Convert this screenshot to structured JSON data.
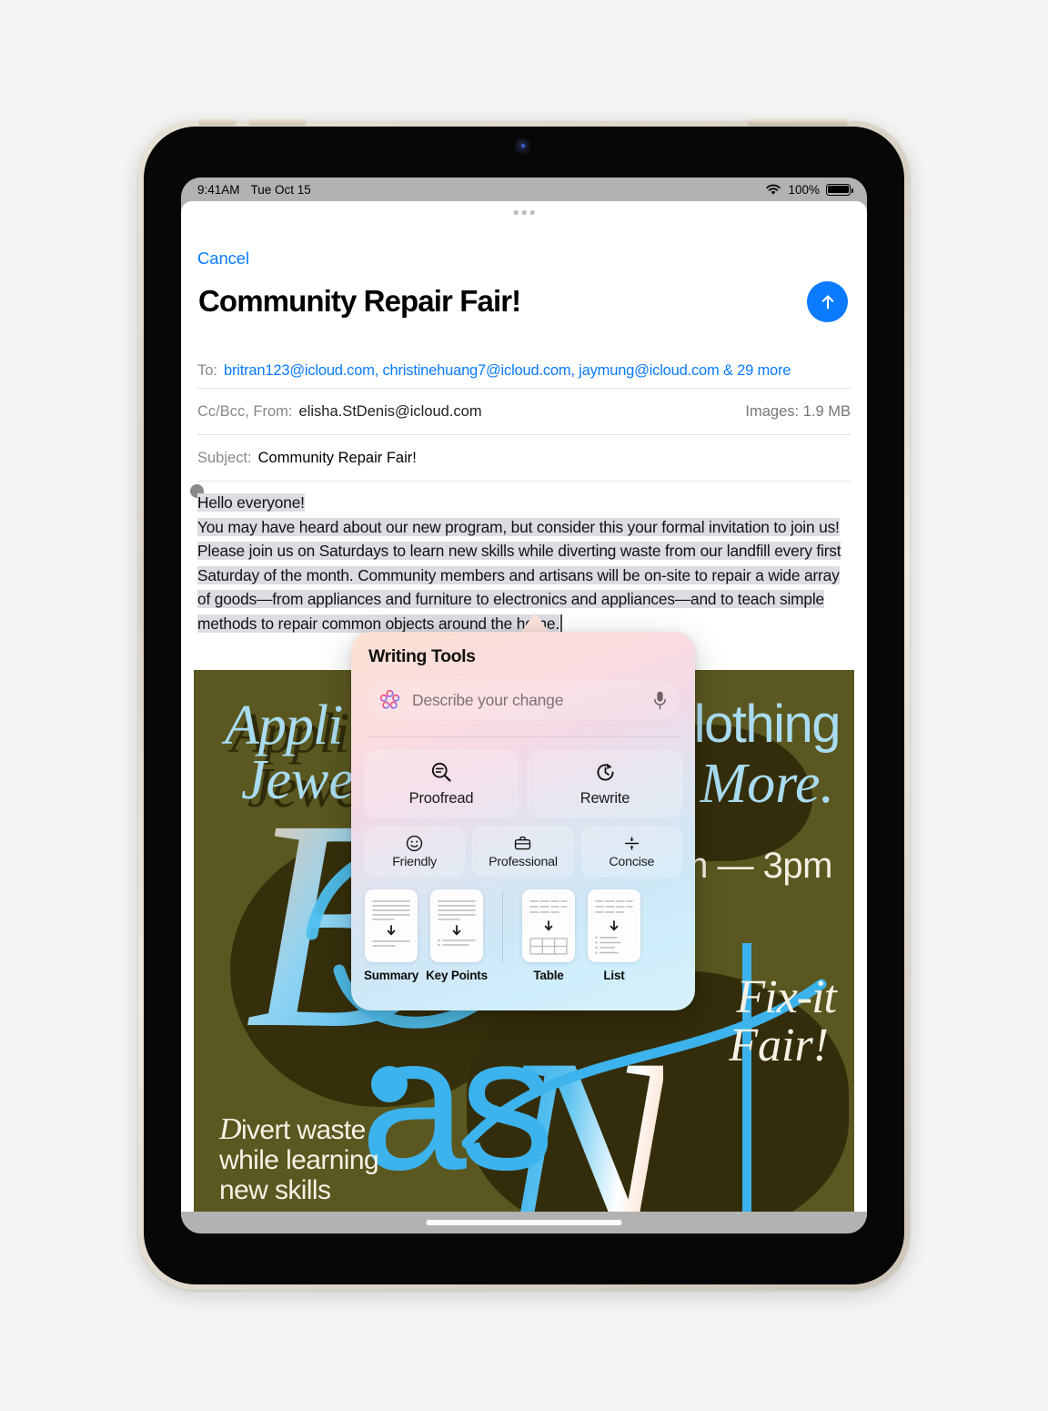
{
  "statusbar": {
    "time": "9:41AM",
    "date": "Tue Oct 15",
    "battery_percent": "100%",
    "wifi_icon": "wifi-icon",
    "battery_icon": "battery-icon"
  },
  "mail": {
    "cancel_label": "Cancel",
    "title": "Community Repair Fair!",
    "send_icon": "arrow-up-icon",
    "to_label": "To:",
    "recipients": "britran123@icloud.com, christinehuang7@icloud.com, jaymung@icloud.com & 29 more",
    "ccbcc_label": "Cc/Bcc, From:",
    "from_address": "elisha.StDenis@icloud.com",
    "images_label": "Images:",
    "images_size": "1.9 MB",
    "subject_label": "Subject:",
    "subject_value": "Community Repair Fair!",
    "body": {
      "line1": "Hello everyone!",
      "paragraph": "You may have heard about our new program, but consider this your formal invitation to join us! Please join us on Saturdays to learn new skills while diverting waste from our landfill every first Saturday of the month. Community members and artisans will be on-site to repair a wide array of goods—from appliances and furniture to electronics and appliances—and to teach simple methods to repair common objects around the home."
    }
  },
  "poster": {
    "appliances": "Appli",
    "jewelry": "Jewe",
    "clothing": "lothing",
    "more": "More.",
    "time_range": "am — 3pm",
    "fixit": "Fix-it",
    "fair": "Fair!",
    "big_as": "as",
    "big_n": "N",
    "big_b": "B",
    "tagline_script": "D",
    "tagline_line1": "ivert waste",
    "tagline_line2": "while learning",
    "tagline_line3": "new skills"
  },
  "writing_tools": {
    "title": "Writing Tools",
    "input_placeholder": "Describe your change",
    "sparkle_icon": "apple-intelligence-icon",
    "mic_icon": "microphone-icon",
    "primary_actions": [
      {
        "label": "Proofread",
        "icon": "magnifier-proofread-icon"
      },
      {
        "label": "Rewrite",
        "icon": "rewrite-clock-icon"
      }
    ],
    "tone_actions": [
      {
        "label": "Friendly",
        "icon": "smiley-face-icon"
      },
      {
        "label": "Professional",
        "icon": "briefcase-icon"
      },
      {
        "label": "Concise",
        "icon": "divide-icon"
      }
    ],
    "document_actions": [
      {
        "label": "Summary",
        "icon": "summary-doc-icon"
      },
      {
        "label": "Key Points",
        "icon": "key-points-doc-icon"
      },
      {
        "label": "Table",
        "icon": "table-doc-icon"
      },
      {
        "label": "List",
        "icon": "list-doc-icon"
      }
    ]
  },
  "colors": {
    "accent_blue": "#0a7bff",
    "poster_olive": "#5a5720",
    "poster_cyan": "#3cb3ec",
    "selection_gray": "#dcdce2"
  }
}
